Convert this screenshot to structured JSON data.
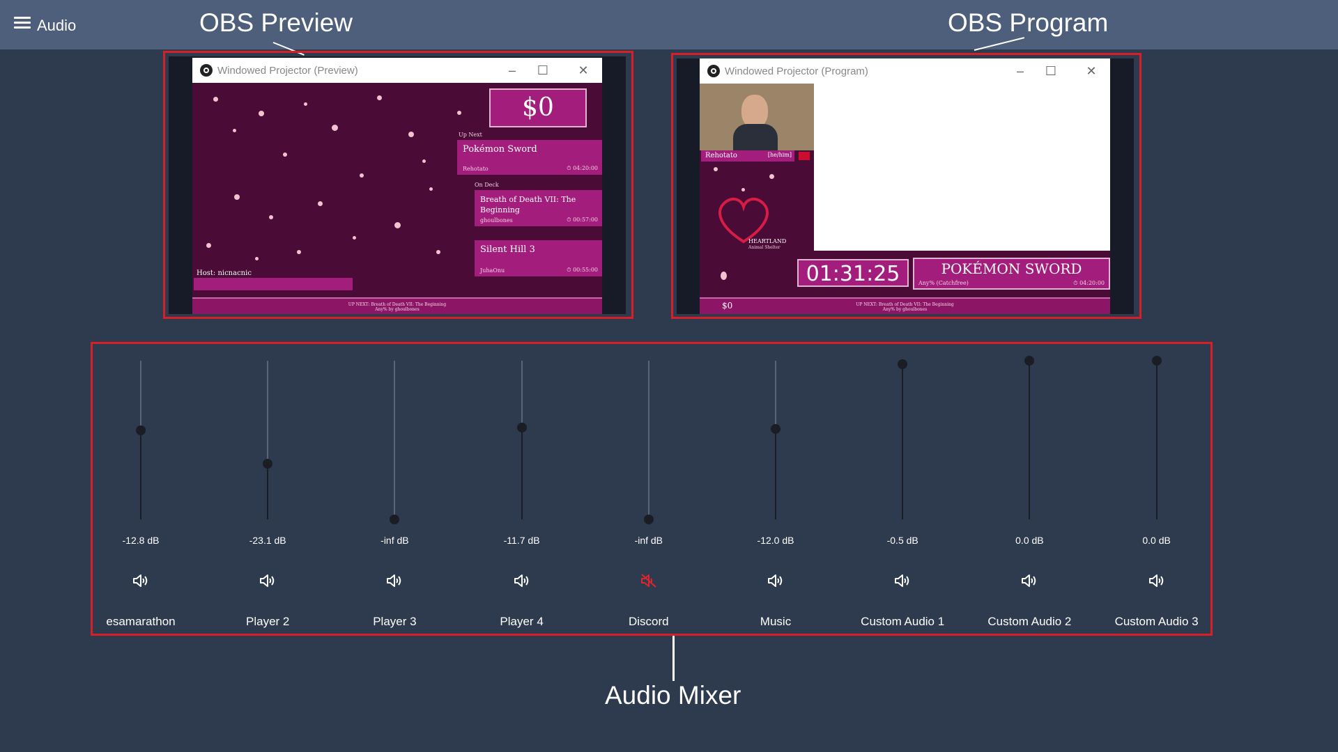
{
  "topbar": {
    "title": "Audio"
  },
  "callouts": {
    "preview": "OBS Preview",
    "program": "OBS Program",
    "mixer": "Audio Mixer"
  },
  "preview": {
    "window_title": "Windowed Projector (Preview)",
    "money": "$0",
    "up_next_label": "Up Next",
    "game1": "Pokémon Sword",
    "game1_runner": "Rehotato",
    "game1_time": "⏱ 04:20:00",
    "on_deck_label": "On Deck",
    "game2": "Breath of Death VII: The Beginning",
    "game2_runner": "ghoulbones",
    "game2_time": "⏱ 00:57:00",
    "game3": "Silent Hill 3",
    "game3_runner": "JuhaOnu",
    "game3_time": "⏱ 00:55:00",
    "host": "Host: nicnacnic",
    "ticker_line1": "UP NEXT: Breath of Death VII: The Beginning",
    "ticker_line2": "Any% by ghoulbones"
  },
  "program": {
    "window_title": "Windowed Projector (Program)",
    "runner_name": "Rehotato",
    "runner_pronouns": "[he/him]",
    "shelter_name": "HEARTLAND",
    "shelter_sub": "Animal Shelter",
    "timer": "01:31:25",
    "game_title": "POKÉMON SWORD",
    "category": "Any% (Catchfree)",
    "estimate": "⏱ 04:20:00",
    "money": "$0",
    "ticker_line1": "UP NEXT: Breath of Death VII: The Beginning",
    "ticker_line2": "Any% by ghoulbones"
  },
  "mixer": {
    "channels": [
      {
        "name": "esamarathon",
        "db": "-12.8 dB",
        "level": 0.56,
        "muted": false
      },
      {
        "name": "Player 2",
        "db": "-23.1 dB",
        "level": 0.35,
        "muted": false
      },
      {
        "name": "Player 3",
        "db": "-inf dB",
        "level": 0.0,
        "muted": false
      },
      {
        "name": "Player 4",
        "db": "-11.7 dB",
        "level": 0.58,
        "muted": false
      },
      {
        "name": "Discord",
        "db": "-inf dB",
        "level": 0.0,
        "muted": true
      },
      {
        "name": "Music",
        "db": "-12.0 dB",
        "level": 0.57,
        "muted": false
      },
      {
        "name": "Custom Audio 1",
        "db": "-0.5 dB",
        "level": 0.98,
        "muted": false
      },
      {
        "name": "Custom Audio 2",
        "db": "0.0 dB",
        "level": 1.0,
        "muted": false
      },
      {
        "name": "Custom Audio 3",
        "db": "0.0 dB",
        "level": 1.0,
        "muted": false
      }
    ]
  },
  "colors": {
    "accent_red": "#d81e27",
    "brand_pink": "#a31e7c",
    "muted_icon": "#e0262d"
  }
}
